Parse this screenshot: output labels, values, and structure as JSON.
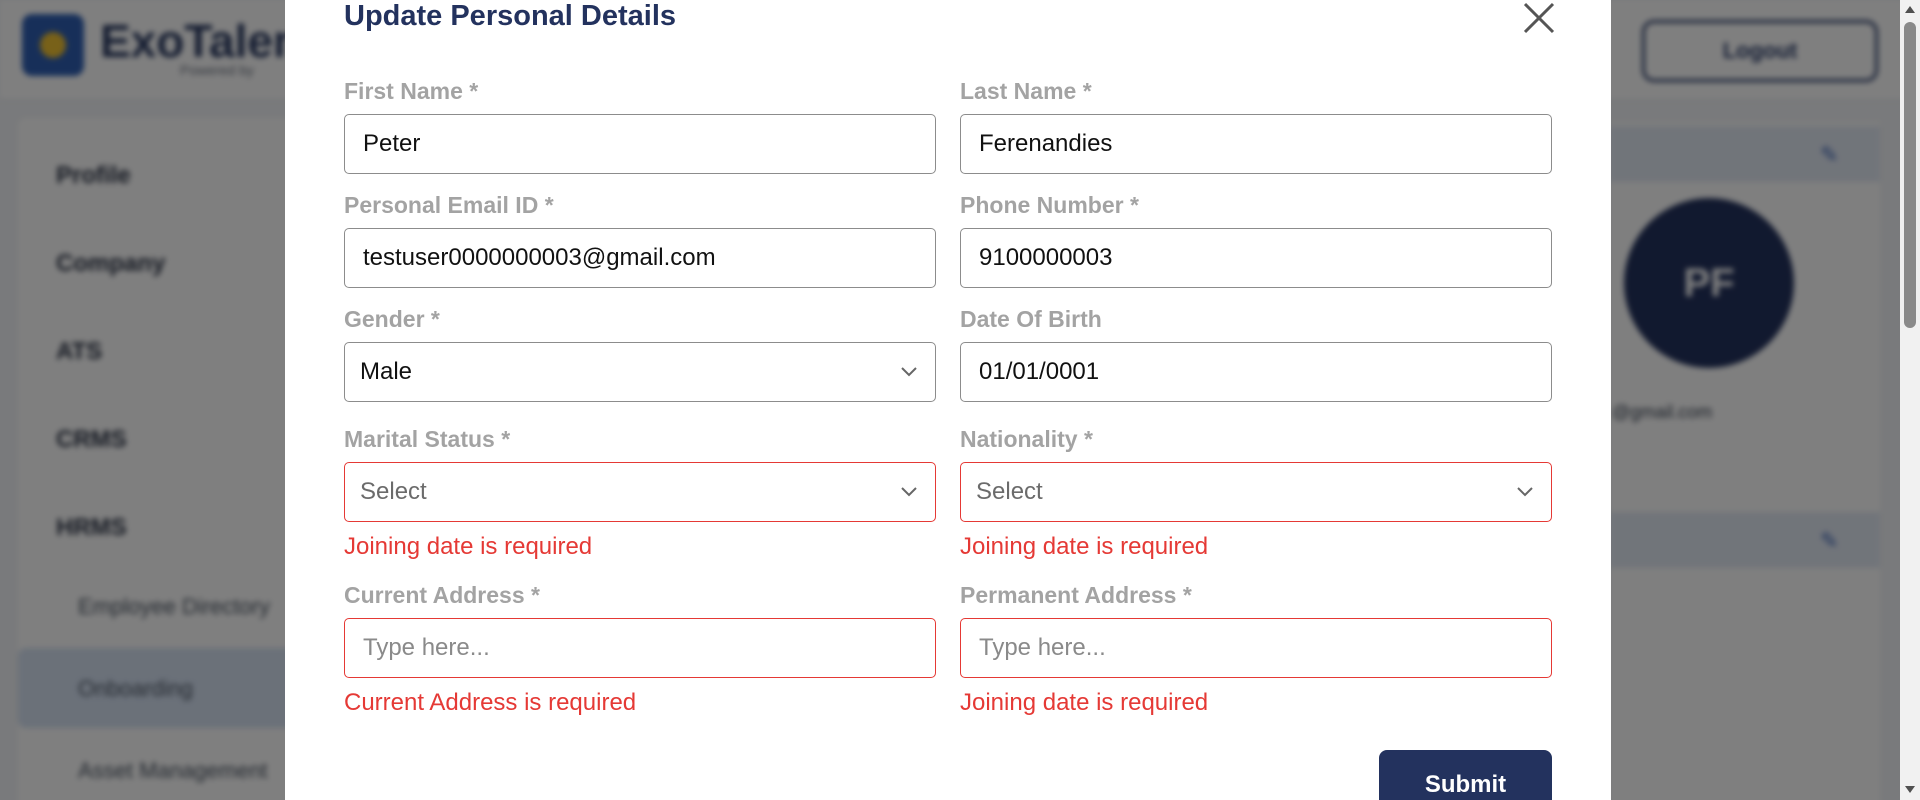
{
  "background": {
    "logo_text": "ExoTalent",
    "logo_sub": "Powered by",
    "logout_label": "Logout",
    "sidebar": [
      {
        "label": "Profile"
      },
      {
        "label": "Company"
      },
      {
        "label": "ATS"
      },
      {
        "label": "CRMS"
      },
      {
        "label": "HRMS"
      }
    ],
    "sidebar_sub": [
      {
        "label": "Employee Directory"
      },
      {
        "label": "Onboarding"
      },
      {
        "label": "Asset Management"
      }
    ],
    "avatar_initials": "PF",
    "email_fragment": "@gmail.com"
  },
  "modal": {
    "title": "Update Personal Details",
    "fields": {
      "first_name": {
        "label": "First Name *",
        "value": "Peter"
      },
      "last_name": {
        "label": "Last Name *",
        "value": "Ferenandies"
      },
      "email": {
        "label": "Personal Email ID *",
        "value": "testuser0000000003@gmail.com"
      },
      "phone": {
        "label": "Phone Number *",
        "value": "9100000003"
      },
      "gender": {
        "label": "Gender *",
        "value": "Male"
      },
      "dob": {
        "label": "Date Of Birth",
        "value": "01/01/0001"
      },
      "marital_status": {
        "label": "Marital Status *",
        "value": "Select",
        "error": "Joining date is required"
      },
      "nationality": {
        "label": "Nationality *",
        "value": "Select",
        "error": "Joining date is required"
      },
      "current_address": {
        "label": "Current Address *",
        "placeholder": "Type here...",
        "error": "Current Address is required"
      },
      "permanent_address": {
        "label": "Permanent Address *",
        "placeholder": "Type here...",
        "error": "Joining date is required"
      }
    },
    "submit_label": "Submit"
  },
  "colors": {
    "primary": "#23325e",
    "error": "#e53935",
    "label": "#a3a3a3"
  }
}
